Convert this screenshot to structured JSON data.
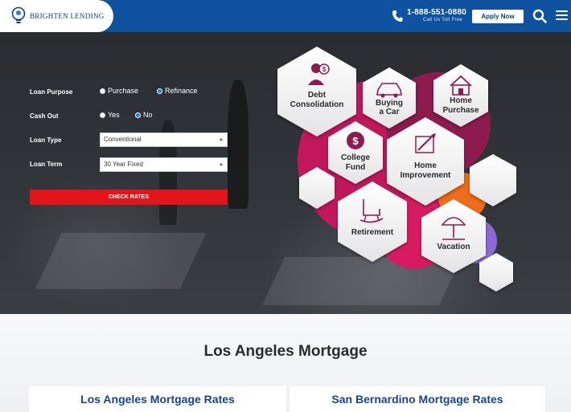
{
  "header": {
    "logo_text": "Brighten Lending",
    "phone": "1-888-551-0880",
    "phone_sub": "Call Us Toll Free",
    "apply_label": "Apply Now",
    "brand_color": "#0f52a0",
    "icons": [
      "lightbulb-logo-icon",
      "phone-icon",
      "search-icon",
      "hamburger-menu-icon"
    ]
  },
  "form": {
    "purpose_label": "Loan Purpose",
    "purpose_options": [
      "Purchase",
      "Refinance"
    ],
    "purpose_selected": "Refinance",
    "cashout_label": "Cash Out",
    "cashout_options": [
      "Yes",
      "No"
    ],
    "cashout_selected": "No",
    "type_label": "Loan Type",
    "type_value": "Conventional",
    "term_label": "Loan Term",
    "term_value": "30 Year Fixed",
    "submit_label": "CHECK RATES",
    "submit_color": "#e3151a"
  },
  "hexagons": [
    {
      "line1": "Debt",
      "line2": "Consolidation",
      "icon": "debt-person-icon"
    },
    {
      "line1": "Buying",
      "line2": "a Car",
      "icon": "car-icon"
    },
    {
      "line1": "Home",
      "line2": "Purchase",
      "icon": "house-icon"
    },
    {
      "line1": "College",
      "line2": "Fund",
      "icon": "dollar-coin-icon"
    },
    {
      "line1": "Home",
      "line2": "Improvement",
      "icon": "tools-icon"
    },
    {
      "line1": "Retirement",
      "line2": "",
      "icon": "rocking-chair-icon"
    },
    {
      "line1": "Vacation",
      "line2": "",
      "icon": "beach-umbrella-icon"
    }
  ],
  "section": {
    "title": "Los Angeles Mortgage",
    "cards": [
      "Los Angeles Mortgage Rates",
      "San Bernardino Mortgage Rates"
    ]
  }
}
